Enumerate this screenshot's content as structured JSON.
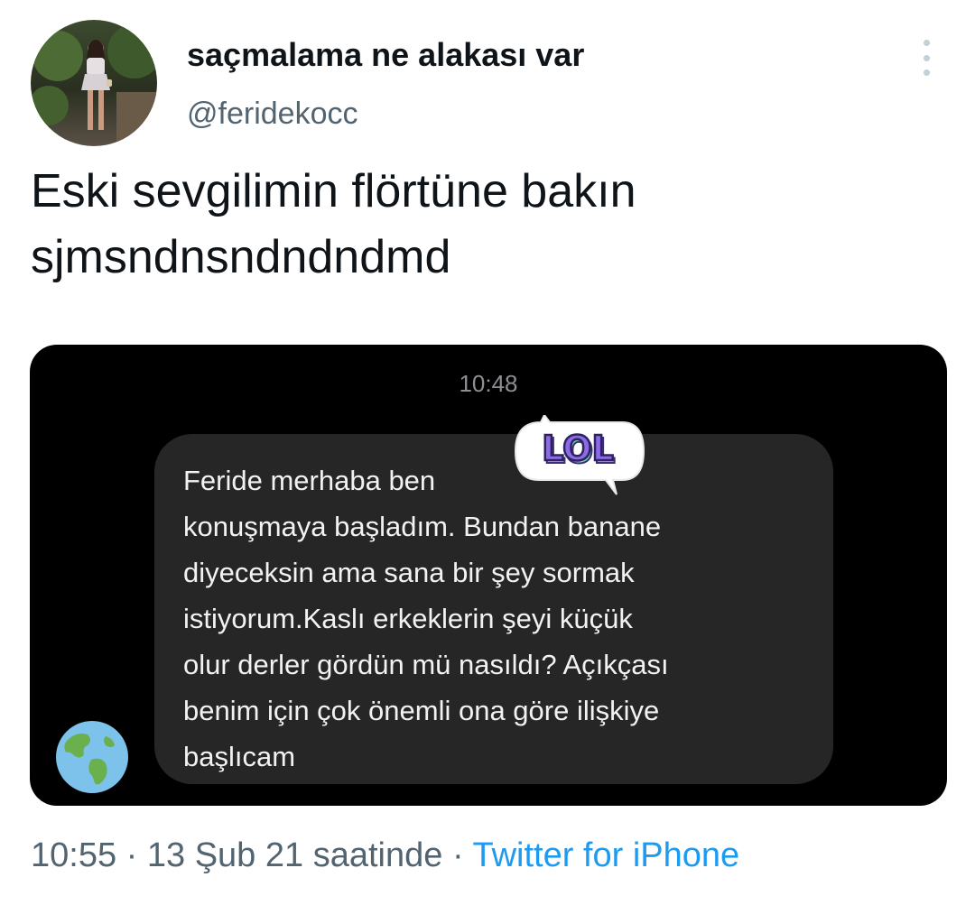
{
  "header": {
    "display_name": "saçmalama ne alakası var",
    "username": "@feridekocc"
  },
  "tweet": {
    "lines": [
      "Eski sevgilimin flörtüne bakın",
      "sjmsndnsndndndmd"
    ]
  },
  "media": {
    "time": "10:48",
    "message_lines": [
      "Feride merhaba ben",
      "konuşmaya başladım. Bundan banane",
      "diyeceksin ama sana bir şey sormak",
      "istiyorum.Kaslı erkeklerin şeyi küçük",
      "olur derler gördün mü nasıldı? Açıkçası",
      "benim için çok önemli ona göre ilişkiye",
      "başlıcam"
    ],
    "sticker_text": "LOL",
    "icons": {
      "more": "more-vertical-icon",
      "globe": "globe-icon"
    }
  },
  "footer": {
    "time": "10:55",
    "separator": "·",
    "date": "13 Şub 21 saatinde",
    "source": "Twitter for iPhone"
  },
  "colors": {
    "accent": "#1d9bf0",
    "secondary_text": "#536471",
    "bubble": "#262626",
    "sticker_purple": "#8f6ae6",
    "sticker_green": "#6fe0a6"
  }
}
